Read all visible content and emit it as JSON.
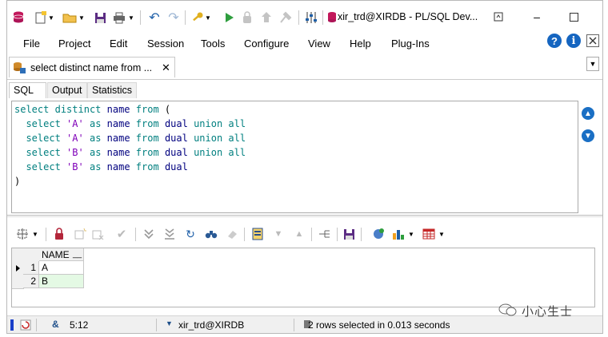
{
  "window": {
    "title": "xir_trd@XIRDB - PL/SQL Dev..."
  },
  "menu": [
    "File",
    "Project",
    "Edit",
    "Session",
    "Tools",
    "Configure",
    "View",
    "Help",
    "Plug-Ins"
  ],
  "doc_tab": {
    "label": "select distinct name from ..."
  },
  "subtabs": [
    "SQL",
    "Output",
    "Statistics"
  ],
  "sql_code": {
    "line1": [
      "select",
      "distinct",
      "name",
      "from",
      "("
    ],
    "line2": [
      "select",
      "'A'",
      "as",
      "name",
      "from",
      "dual",
      "union all"
    ],
    "line3": [
      "select",
      "'A'",
      "as",
      "name",
      "from",
      "dual",
      "union all"
    ],
    "line4": [
      "select",
      "'B'",
      "as",
      "name",
      "from",
      "dual",
      "union all"
    ],
    "line5": [
      "select",
      "'B'",
      "as",
      "name",
      "from",
      "dual"
    ],
    "line6": [
      ")"
    ]
  },
  "grid": {
    "column_header": "NAME",
    "rows": [
      {
        "num": "1",
        "value": "A"
      },
      {
        "num": "2",
        "value": "B"
      }
    ]
  },
  "status": {
    "cursor_pos": "5:12",
    "connection": "xir_trd@XIRDB",
    "message": "2 rows selected in 0.013 seconds"
  },
  "watermark": "小心生士",
  "colors": {
    "keyword": "#007f7f",
    "object": "#00007f",
    "string": "#7f00b8",
    "selected_row": "#e4f9e4"
  }
}
